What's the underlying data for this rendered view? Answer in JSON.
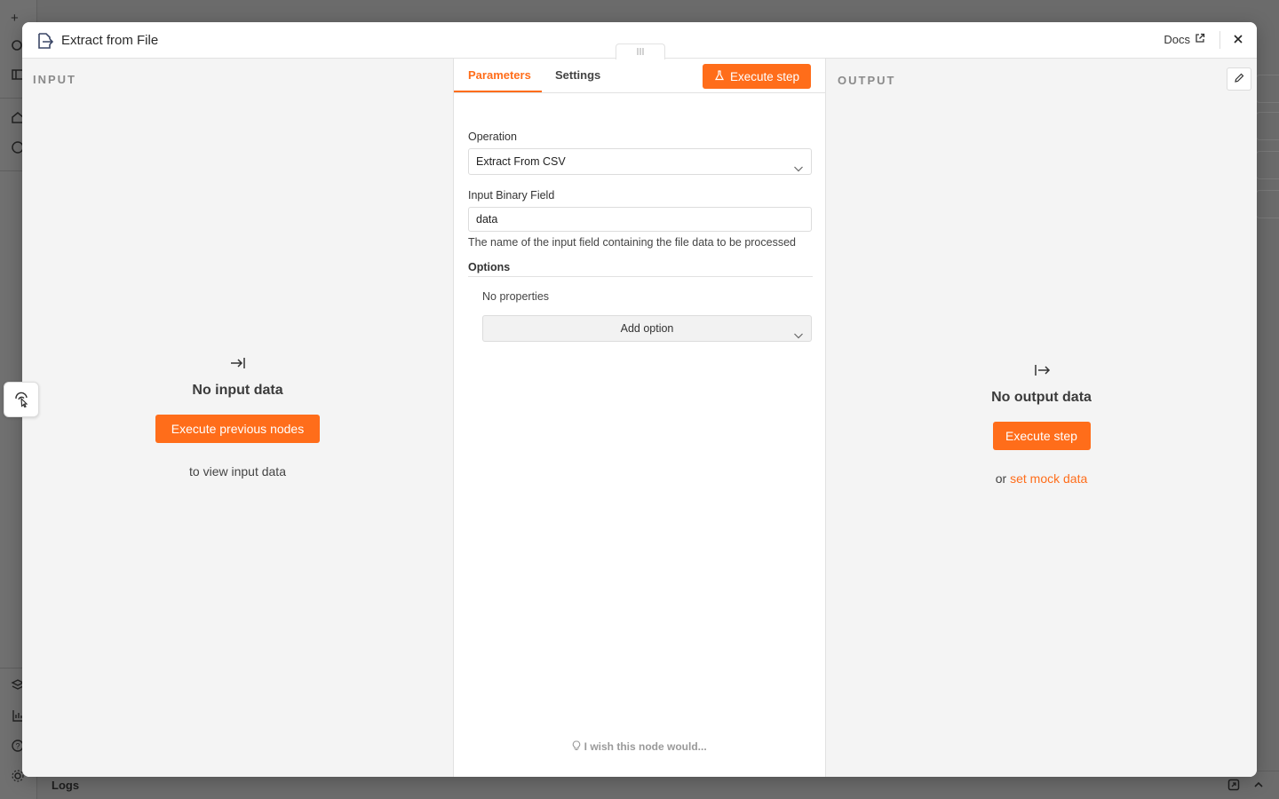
{
  "background": {
    "logs_label": "Logs"
  },
  "modal": {
    "title": "Extract from File",
    "docs_label": "Docs"
  },
  "input_panel": {
    "label": "INPUT",
    "empty_title": "No input data",
    "execute_button": "Execute previous nodes",
    "subtitle": "to view input data"
  },
  "params_panel": {
    "tabs": [
      {
        "label": "Parameters",
        "active": true
      },
      {
        "label": "Settings",
        "active": false
      }
    ],
    "execute_button": "Execute step",
    "operation_label": "Operation",
    "operation_value": "Extract From CSV",
    "binary_field_label": "Input Binary Field",
    "binary_field_value": "data",
    "binary_field_hint": "The name of the input field containing the file data to be processed",
    "options_label": "Options",
    "no_properties": "No properties",
    "add_option": "Add option",
    "wish_text": "I wish this node would..."
  },
  "output_panel": {
    "label": "OUTPUT",
    "empty_title": "No output data",
    "execute_button": "Execute step",
    "or_text": "or",
    "mock_link": "set mock data"
  },
  "colors": {
    "accent": "#ff6d1a",
    "panel_bg": "#f4f4f4",
    "overlay": "#6b6b6b"
  }
}
